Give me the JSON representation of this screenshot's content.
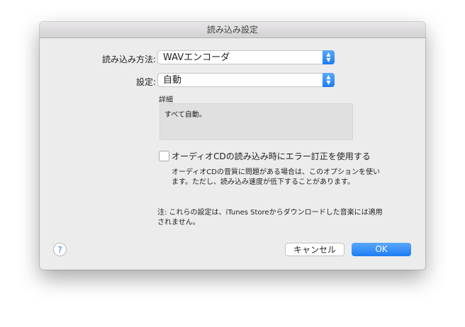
{
  "window": {
    "title": "読み込み設定"
  },
  "import_method": {
    "label": "読み込み方法:",
    "value": "WAVエンコーダ"
  },
  "setting": {
    "label": "設定:",
    "value": "自動"
  },
  "details": {
    "label": "詳細",
    "text": "すべて自動。"
  },
  "error_correction": {
    "label": "オーディオCDの読み込み時にエラー訂正を使用する",
    "checked": false,
    "description_line1": "オーディオCDの音質に問題がある場合は、このオプションを使い",
    "description_line2": "ます。ただし、読み込み速度が低下することがあります。"
  },
  "note": {
    "line1": "注: これらの設定は、iTunes Storeからダウンロードした音楽には適用",
    "line2": "されません。"
  },
  "buttons": {
    "help": "?",
    "cancel": "キャンセル",
    "ok": "OK"
  },
  "colors": {
    "accent": "#1d7cf2"
  }
}
